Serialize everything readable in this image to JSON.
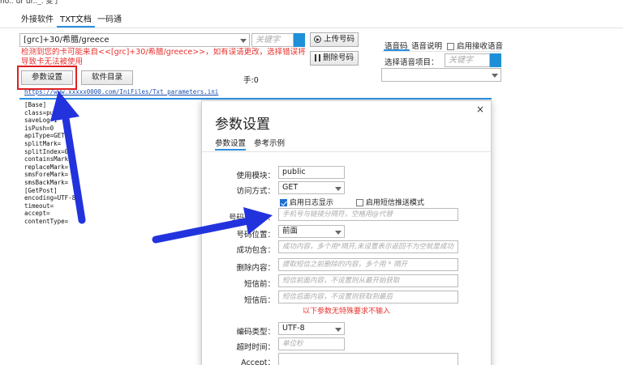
{
  "top_clipped_text": "ho.. ur ur.._. 变了",
  "tabs": [
    {
      "label": "外接软件"
    },
    {
      "label": "TXT文档"
    },
    {
      "label": "一码通"
    }
  ],
  "source_combo": {
    "value": "[grc]+30/希腊/greece"
  },
  "keyword_input": {
    "placeholder": "关键字"
  },
  "upload_button": {
    "label": "上传号码"
  },
  "delete_button": {
    "label": "删除号码"
  },
  "warning_text": "检测到您的卡可能来自<<[grc]+30/希腊/greece>>，如有误请更改，选择错误将导致卡无法被使用",
  "param_settings_button": {
    "label": "参数设置"
  },
  "software_dir_button": {
    "label": "软件目录"
  },
  "phone_count": "手:0",
  "voice_panel": {
    "tab_voice_code": "语音码",
    "tab_voice_desc": "语音说明",
    "enable_receive_label": "启用接收语音",
    "select_item_label": "选择语音项目：",
    "keyword_placeholder": "关键字"
  },
  "params_link": "https://www.xxxxx0000.com/IniFiles/Txt_parameters.ini",
  "ini_lines": [
    "[Base]",
    "class=public",
    "saveLog=1",
    "isPush=0",
    "apiType=GET",
    "splitMark=",
    "splitIndex=0",
    "containsMark=",
    "replaceMark=",
    "smsForeMark=",
    "smsBackMark=",
    "[GetPost]",
    "encoding=UTF-8",
    "timeout=",
    "accept=",
    "contentType="
  ],
  "dialog": {
    "title": "参数设置",
    "close": "×",
    "tabs": [
      {
        "label": "参数设置"
      },
      {
        "label": "参考示例"
      }
    ],
    "fields": {
      "module": {
        "label": "使用模块：",
        "value": "public"
      },
      "method": {
        "label": "访问方式：",
        "value": "GET"
      },
      "enable_log": "启用日志显示",
      "enable_sms_push": "启用短信推送模式",
      "number_split": {
        "label": "号码分隔符：",
        "placeholder": "手机号与链接分隔符，空格用@代替"
      },
      "number_position": {
        "label": "号码位置：",
        "value": "前面"
      },
      "success_contains": {
        "label": "成功包含：",
        "placeholder": "成功内容，多个用*隔开,未设置表示返回不为空就是成功"
      },
      "delete_content": {
        "label": "删除内容：",
        "placeholder": "提取短信之前删除的内容，多个用 * 隔开"
      },
      "sms_before": {
        "label": "短信前：",
        "placeholder": "短信前面内容，不设置则从最开始获取"
      },
      "sms_after": {
        "label": "短信后：",
        "placeholder": "短信后面内容，不设置则获取到最后"
      },
      "note": "以下参数无特殊要求不输入",
      "encoding": {
        "label": "编码类型：",
        "value": "UTF-8"
      },
      "timeout": {
        "label": "超时时间：",
        "placeholder": "单位秒"
      },
      "accept": {
        "label": "Accept："
      }
    }
  },
  "colors": {
    "accent": "#2d8fe0",
    "warning": "#e8312e",
    "highlight_box": "#e02020",
    "arrow": "#2233dd"
  }
}
